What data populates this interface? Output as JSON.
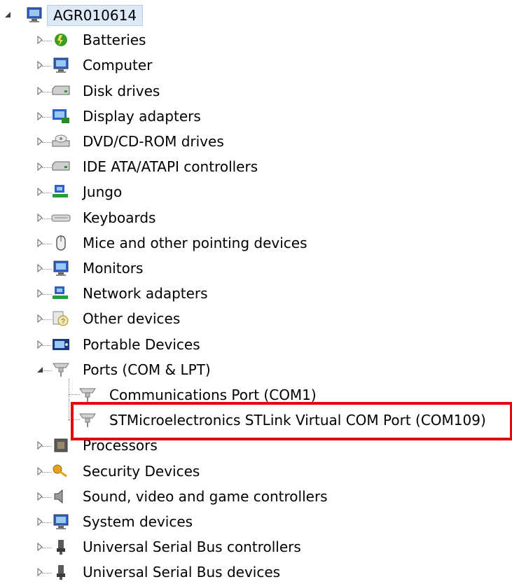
{
  "tree": {
    "root": {
      "label": "AGR010614",
      "icon": "computer-network-icon",
      "expanded": true
    },
    "categories": [
      {
        "name": "batteries",
        "label": "Batteries",
        "icon": "battery-icon",
        "expanded": false,
        "color": "#3a9b2a"
      },
      {
        "name": "computer",
        "label": "Computer",
        "icon": "computer-icon",
        "expanded": false,
        "color": "#2a62c8"
      },
      {
        "name": "disk-drives",
        "label": "Disk drives",
        "icon": "disk-drive-icon",
        "expanded": false,
        "color": "#9a9a9a"
      },
      {
        "name": "display-adapters",
        "label": "Display adapters",
        "icon": "display-adapter-icon",
        "expanded": false,
        "color": "#2a62c8"
      },
      {
        "name": "dvd-cd-rom",
        "label": "DVD/CD-ROM drives",
        "icon": "optical-drive-icon",
        "expanded": false,
        "color": "#9a9a9a"
      },
      {
        "name": "ide-ata",
        "label": "IDE ATA/ATAPI controllers",
        "icon": "ide-controller-icon",
        "expanded": false,
        "color": "#9a9a9a"
      },
      {
        "name": "jungo",
        "label": "Jungo",
        "icon": "jungo-icon",
        "expanded": false,
        "color": "#2a9b3a"
      },
      {
        "name": "keyboards",
        "label": "Keyboards",
        "icon": "keyboard-icon",
        "expanded": false,
        "color": "#8a8a8a"
      },
      {
        "name": "mice",
        "label": "Mice and other pointing devices",
        "icon": "mouse-icon",
        "expanded": false,
        "color": "#8a8a8a"
      },
      {
        "name": "monitors",
        "label": "Monitors",
        "icon": "monitor-icon",
        "expanded": false,
        "color": "#2a62c8"
      },
      {
        "name": "network-adapters",
        "label": "Network adapters",
        "icon": "network-adapter-icon",
        "expanded": false,
        "color": "#2a9b3a"
      },
      {
        "name": "other-devices",
        "label": "Other devices",
        "icon": "unknown-device-icon",
        "expanded": false,
        "color": "#c8a020"
      },
      {
        "name": "portable-devices",
        "label": "Portable Devices",
        "icon": "portable-device-icon",
        "expanded": false,
        "color": "#1a3a7a"
      },
      {
        "name": "ports",
        "label": "Ports (COM & LPT)",
        "icon": "port-icon",
        "expanded": true,
        "color": "#8a8a8a",
        "children": [
          {
            "name": "com1",
            "label": "Communications Port (COM1)",
            "icon": "port-icon"
          },
          {
            "name": "stlink",
            "label": "STMicroelectronics STLink Virtual COM Port (COM109)",
            "icon": "port-icon",
            "highlighted": true
          }
        ]
      },
      {
        "name": "processors",
        "label": "Processors",
        "icon": "processor-icon",
        "expanded": false,
        "color": "#6a6a6a"
      },
      {
        "name": "security-devices",
        "label": "Security Devices",
        "icon": "key-icon",
        "expanded": false,
        "color": "#e0a020"
      },
      {
        "name": "sound",
        "label": "Sound, video and game controllers",
        "icon": "speaker-icon",
        "expanded": false,
        "color": "#6a6a6a"
      },
      {
        "name": "system-devices",
        "label": "System devices",
        "icon": "system-icon",
        "expanded": false,
        "color": "#2a62c8"
      },
      {
        "name": "usb-controllers",
        "label": "Universal Serial Bus controllers",
        "icon": "usb-icon",
        "expanded": false,
        "color": "#5a5a5a"
      },
      {
        "name": "usb-devices",
        "label": "Universal Serial Bus devices",
        "icon": "usb-icon",
        "expanded": false,
        "color": "#5a5a5a"
      }
    ]
  },
  "highlight_color": "#e10a0a"
}
